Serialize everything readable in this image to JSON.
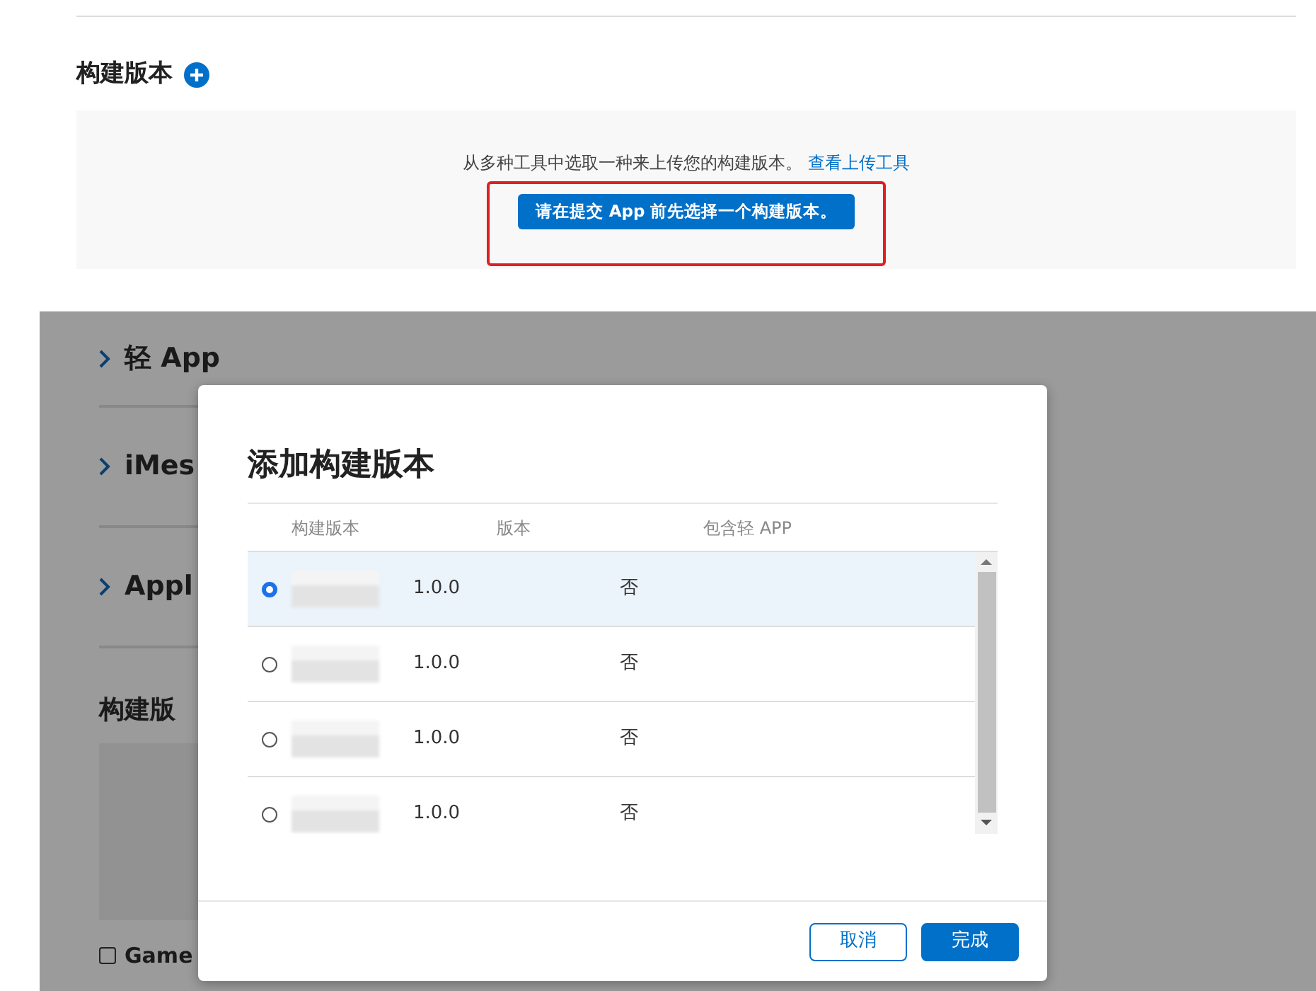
{
  "section": {
    "title": "构建版本",
    "description": "从多种工具中选取一种来上传您的构建版本。",
    "link": "查看上传工具",
    "button": "请在提交 App 前先选择一个构建版本。",
    "highlighted": true
  },
  "background_page": {
    "sections": [
      {
        "label": "轻 App"
      },
      {
        "label": "iMes"
      },
      {
        "label": "Appl"
      }
    ],
    "heading": "构建版",
    "checkbox": {
      "label": "Game",
      "checked": false
    }
  },
  "dialog": {
    "title": "添加构建版本",
    "columns": [
      "构建版本",
      "版本",
      "包含轻 APP"
    ],
    "rows": [
      {
        "selected": true,
        "version": "1.0.0",
        "app_clip": "否"
      },
      {
        "selected": false,
        "version": "1.0.0",
        "app_clip": "否"
      },
      {
        "selected": false,
        "version": "1.0.0",
        "app_clip": "否"
      },
      {
        "selected": false,
        "version": "1.0.0",
        "app_clip": "否"
      }
    ],
    "buttons": [
      {
        "label": "取消",
        "kind": "secondary"
      },
      {
        "label": "完成",
        "kind": "primary"
      }
    ]
  }
}
